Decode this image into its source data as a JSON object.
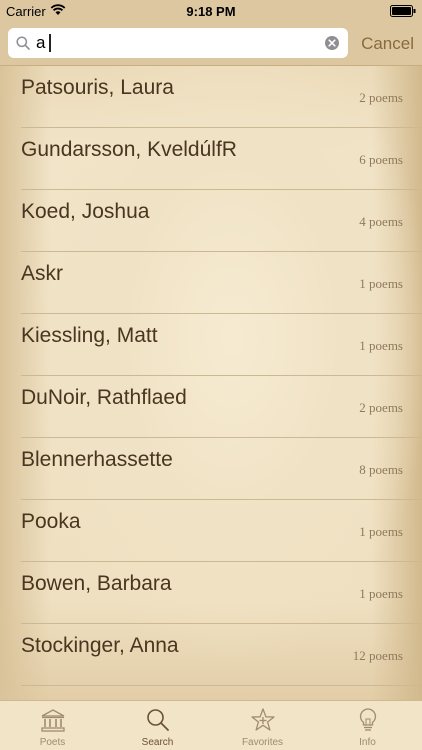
{
  "status": {
    "carrier": "Carrier",
    "time": "9:18 PM"
  },
  "search": {
    "value": "a",
    "cancel_label": "Cancel"
  },
  "rows": [
    {
      "name": "Patsouris, Laura",
      "count": "2 poems"
    },
    {
      "name": "Gundarsson, KveldúlfR",
      "count": "6 poems"
    },
    {
      "name": "Koed, Joshua",
      "count": "4 poems"
    },
    {
      "name": "Askr",
      "count": "1 poems"
    },
    {
      "name": "Kiessling, Matt",
      "count": "1 poems"
    },
    {
      "name": "DuNoir, Rathflaed",
      "count": "2 poems"
    },
    {
      "name": "Blennerhassette",
      "count": "8 poems"
    },
    {
      "name": "Pooka",
      "count": "1 poems"
    },
    {
      "name": "Bowen, Barbara",
      "count": "1 poems"
    },
    {
      "name": "Stockinger, Anna",
      "count": "12 poems"
    }
  ],
  "tabs": [
    {
      "label": "Poets",
      "icon": "museum-icon"
    },
    {
      "label": "Search",
      "icon": "search-icon"
    },
    {
      "label": "Favorites",
      "icon": "star-icon"
    },
    {
      "label": "Info",
      "icon": "lightbulb-icon"
    }
  ],
  "colors": {
    "accent": "#8a6a3e",
    "text": "#4a3620",
    "bar": "#ddc7a0"
  }
}
